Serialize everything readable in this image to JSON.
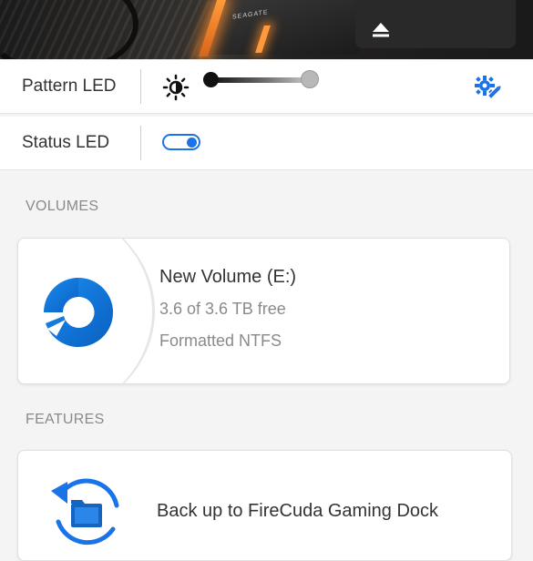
{
  "hero": {
    "brand_text": "SEAGATE",
    "eject_icon": "eject-icon"
  },
  "led": {
    "pattern_label": "Pattern LED",
    "status_label": "Status LED",
    "brightness_icon": "brightness-icon",
    "brightness_level": 1.0,
    "status_enabled": true,
    "edit_icon": "edit-pattern-icon",
    "accent_color": "#1a73e8"
  },
  "volumes": {
    "heading": "VOLUMES",
    "items": [
      {
        "name": "New Volume (E:)",
        "free": "3.6 of 3.6 TB free",
        "format": "Formatted NTFS",
        "icon": "disc-icon"
      }
    ]
  },
  "features": {
    "heading": "FEATURES",
    "items": [
      {
        "label": "Back up to FireCuda Gaming Dock",
        "icon": "backup-folder-icon"
      }
    ]
  }
}
